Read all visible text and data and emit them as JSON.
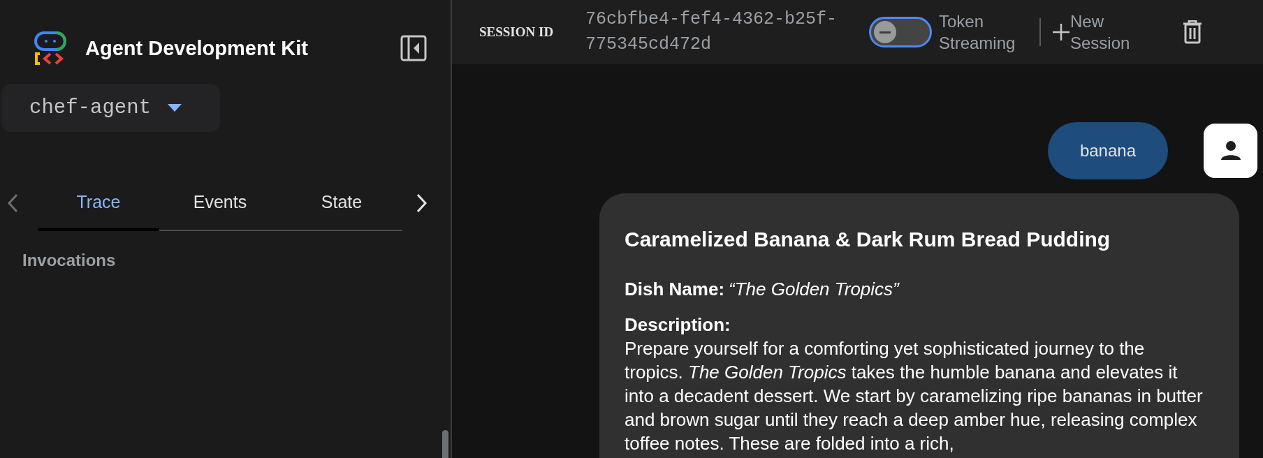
{
  "sidebar": {
    "title": "Agent Development Kit",
    "agent_select": {
      "value": "chef-agent"
    },
    "tab_scroll": {
      "left_disabled": true,
      "right_disabled": false
    },
    "tabs": [
      {
        "label": "Trace",
        "selected": true
      },
      {
        "label": "Events",
        "selected": false
      },
      {
        "label": "State",
        "selected": false
      }
    ],
    "section_heading": "Invocations"
  },
  "top_bar": {
    "session_label": "SESSION ID",
    "session_id": "76cbfbe4-fef4-4362-b25f-775345cd472d",
    "token_streaming": {
      "label": "Token Streaming",
      "on": false
    },
    "new_session": "New Session"
  },
  "messages": [
    {
      "kind": "user",
      "text": "banana"
    },
    {
      "kind": "agent",
      "title": "Caramelized Banana & Dark Rum Bread Pudding",
      "dish_name_label": "Dish Name:",
      "dish_name": "“The Golden Tropics”",
      "description_label": "Description:",
      "description": "Prepare yourself for a comforting yet sophisticated journey to the tropics. *The Golden Tropics* takes the humble banana and elevates it into a decadent dessert. We start by caramelizing ripe bananas in butter and brown sugar until they reach a deep amber hue, releasing complex toffee notes. These are folded into a rich,"
    }
  ]
}
